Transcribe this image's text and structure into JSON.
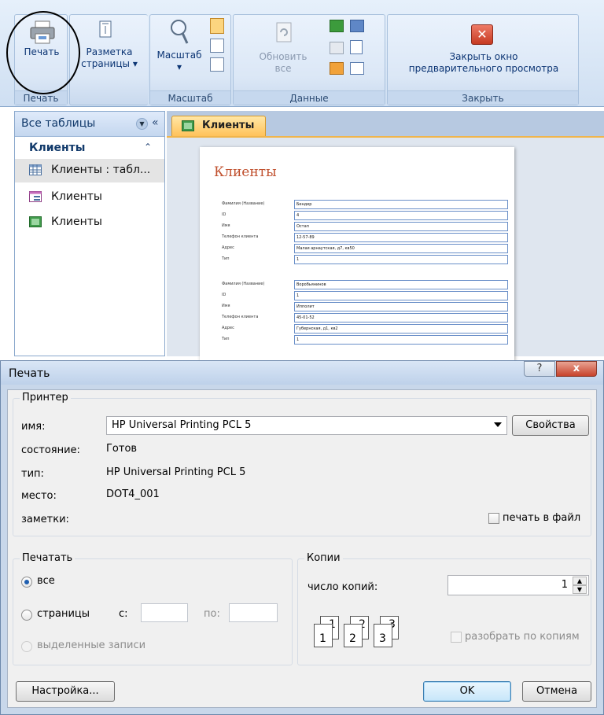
{
  "ribbon": {
    "groups": {
      "print": {
        "label": "Печать",
        "button": "Печать"
      },
      "layout": {
        "button_line1": "Разметка",
        "button_line2": "страницы"
      },
      "zoom": {
        "label": "Масштаб",
        "button": "Масштаб"
      },
      "data": {
        "label": "Данные",
        "refresh_line1": "Обновить",
        "refresh_line2": "все"
      },
      "close": {
        "label": "Закрыть",
        "button_line1": "Закрыть окно",
        "button_line2": "предварительного просмотра"
      }
    }
  },
  "nav": {
    "title": "Все таблицы",
    "collapse": "«",
    "group": "Клиенты",
    "items": [
      {
        "label": "Клиенты : табл...",
        "kind": "table"
      },
      {
        "label": "Клиенты",
        "kind": "form"
      },
      {
        "label": "Клиенты",
        "kind": "report"
      }
    ]
  },
  "document": {
    "tab": "Клиенты",
    "report_title": "Клиенты",
    "records": [
      {
        "rows": [
          {
            "label": "Фамилия (Название)",
            "value": "Бендер"
          },
          {
            "label": "ID",
            "value": "4"
          },
          {
            "label": "Имя",
            "value": "Остап"
          },
          {
            "label": "Телефон клиента",
            "value": "12-57-89"
          },
          {
            "label": "Адрес",
            "value": "Малая арнаутская, д7, кв50"
          },
          {
            "label": "Тип",
            "value": "1"
          }
        ]
      },
      {
        "rows": [
          {
            "label": "Фамилия (Название)",
            "value": "Воробьянинов"
          },
          {
            "label": "ID",
            "value": "1"
          },
          {
            "label": "Имя",
            "value": "Ипполит"
          },
          {
            "label": "Телефон клиента",
            "value": "45-01-52"
          },
          {
            "label": "Адрес",
            "value": "Губернская, д1, кв2"
          },
          {
            "label": "Тип",
            "value": "1"
          }
        ]
      }
    ]
  },
  "dialog": {
    "title": "Печать",
    "help": "?",
    "close": "x",
    "printer": {
      "legend": "Принтер",
      "name_label": "имя:",
      "name_value": "HP Universal Printing PCL 5",
      "properties_button": "Свойства",
      "status_label": "состояние:",
      "status_value": "Готов",
      "type_label": "тип:",
      "type_value": "HP Universal Printing PCL 5",
      "where_label": "место:",
      "where_value": "DOT4_001",
      "comment_label": "заметки:",
      "print_to_file": "печать в файл"
    },
    "range": {
      "legend": "Печатать",
      "all": "все",
      "pages": "страницы",
      "from": "с:",
      "to": "по:",
      "selected": "выделенные записи"
    },
    "copies": {
      "legend": "Копии",
      "count_label": "число копий:",
      "count_value": "1",
      "collate": "разобрать по копиям"
    },
    "setup_button": "Настройка...",
    "ok_button": "OK",
    "cancel_button": "Отмена"
  }
}
